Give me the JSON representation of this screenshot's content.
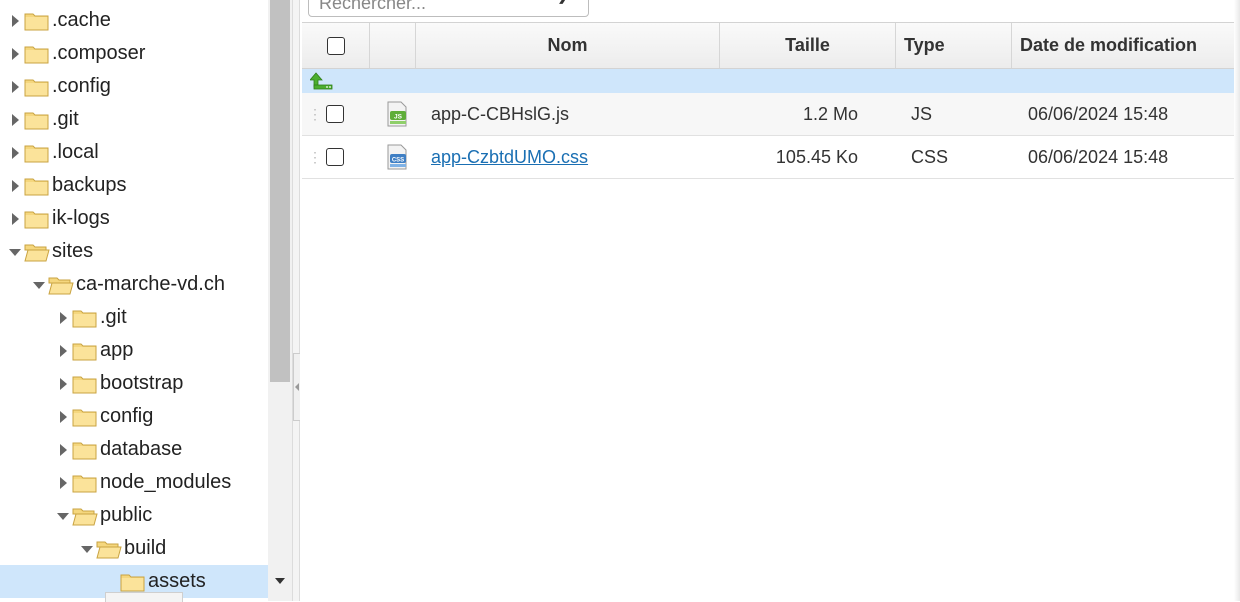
{
  "tree": {
    "items": [
      {
        "label": ".cache",
        "expanded": false,
        "indent": 0
      },
      {
        "label": ".composer",
        "expanded": false,
        "indent": 0
      },
      {
        "label": ".config",
        "expanded": false,
        "indent": 0
      },
      {
        "label": ".git",
        "expanded": false,
        "indent": 0
      },
      {
        "label": ".local",
        "expanded": false,
        "indent": 0
      },
      {
        "label": "backups",
        "expanded": false,
        "indent": 0
      },
      {
        "label": "ik-logs",
        "expanded": false,
        "indent": 0
      },
      {
        "label": "sites",
        "expanded": true,
        "indent": 0
      },
      {
        "label": "ca-marche-vd.ch",
        "expanded": true,
        "indent": 1
      },
      {
        "label": ".git",
        "expanded": false,
        "indent": 2
      },
      {
        "label": "app",
        "expanded": false,
        "indent": 2
      },
      {
        "label": "bootstrap",
        "expanded": false,
        "indent": 2
      },
      {
        "label": "config",
        "expanded": false,
        "indent": 2
      },
      {
        "label": "database",
        "expanded": false,
        "indent": 2
      },
      {
        "label": "node_modules",
        "expanded": false,
        "indent": 2
      },
      {
        "label": "public",
        "expanded": true,
        "indent": 2
      },
      {
        "label": "build",
        "expanded": true,
        "indent": 3
      },
      {
        "label": "assets",
        "expanded": null,
        "indent": 4,
        "selected": true
      }
    ]
  },
  "search": {
    "placeholder": "Rechercher..."
  },
  "grid": {
    "columns": {
      "name": "Nom",
      "size": "Taille",
      "type": "Type",
      "date": "Date de modification"
    },
    "files": [
      {
        "name": "app-C-CBHslG.js",
        "size": "1.2 Mo",
        "type": "JS",
        "date": "06/06/2024 15:48",
        "icon": "js-file-icon",
        "link": false
      },
      {
        "name": "app-CzbtdUMO.css",
        "size": "105.45 Ko",
        "type": "CSS",
        "date": "06/06/2024 15:48",
        "icon": "css-file-icon",
        "link": true
      }
    ]
  },
  "colors": {
    "selected_bg": "#cfe6fb",
    "link": "#1a6fb3",
    "folder": "#f5d77e"
  }
}
